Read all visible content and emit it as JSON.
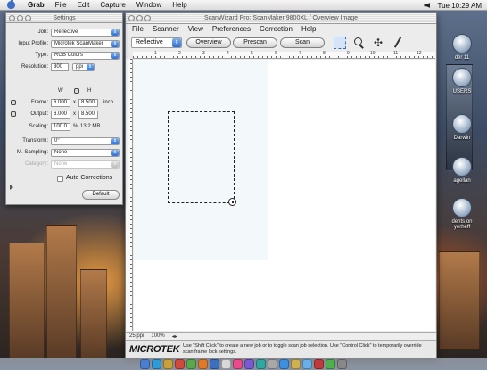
{
  "menubar": {
    "app_name": "Grab",
    "items": [
      "File",
      "Edit",
      "Capture",
      "Window",
      "Help"
    ],
    "clock": "Tue 10:29 AM"
  },
  "settings_panel": {
    "title": "Settings",
    "job_label": "Job:",
    "job_value": "Reflective",
    "input_profile_label": "Input Profile:",
    "input_profile_value": "Microtek ScanMaker",
    "type_label": "Type:",
    "type_value": "RGB Colors",
    "resolution_label": "Resolution:",
    "resolution_value": "300",
    "resolution_unit": "ppi",
    "col_w": "W",
    "col_h": "H",
    "frame_label": "Frame:",
    "frame_w": "6.000",
    "frame_x": "x",
    "frame_h": "8.500",
    "frame_unit": "inch",
    "output_label": "Output:",
    "output_w": "6.000",
    "output_x": "x",
    "output_h": "8.500",
    "scaling_label": "Scaling:",
    "scaling_value": "100.0",
    "scaling_unit": "%",
    "file_size": "13.2 MB",
    "transform_label": "Transform:",
    "transform_value": "0°",
    "msampling_label": "M. Sampling:",
    "msampling_value": "None",
    "category_label": "Category:",
    "category_value": "None",
    "auto_corrections_label": "Auto Corrections",
    "default_button": "Default"
  },
  "main_window": {
    "title": "ScanWizard Pro: ScanMaker 9800XL / Overview Image",
    "menu": [
      "File",
      "Scanner",
      "View",
      "Preferences",
      "Correction",
      "Help"
    ],
    "mode_value": "Reflective",
    "overview_button": "Overview",
    "prescan_button": "Prescan",
    "scan_button": "Scan",
    "ruler_numbers": [
      "1",
      "2",
      "3",
      "4",
      "5",
      "6",
      "7",
      "8",
      "9",
      "10",
      "11",
      "12"
    ],
    "status_ppi": "25 ppi",
    "status_zoom": "100%",
    "logo": "MICROTEK",
    "help_text": "Use \"Shift Click\" to create a new job or to toggle scan job selection. Use \"Control Click\" to temporarily override scan frame lock settings."
  },
  "desktop_icons": [
    {
      "label": "der 11"
    },
    {
      "label": "USERS"
    },
    {
      "label": "Darwin"
    },
    {
      "label": "agellan"
    },
    {
      "label": "dents on yerheff"
    }
  ]
}
